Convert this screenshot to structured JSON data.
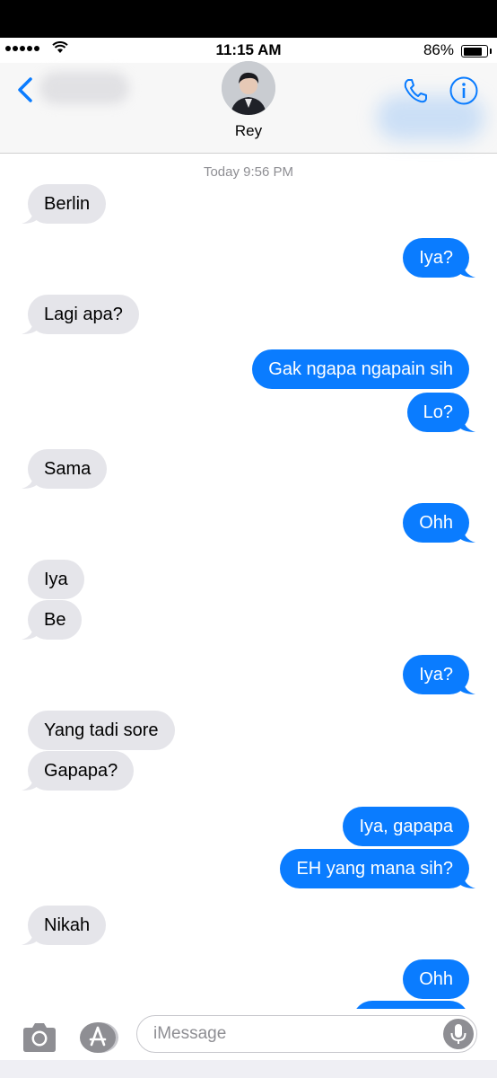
{
  "status_bar": {
    "time": "11:15 AM",
    "battery": "86%"
  },
  "header": {
    "contact_name": "Rey"
  },
  "thread": {
    "timestamp": "Today 9:56 PM",
    "messages": [
      {
        "dir": "in",
        "text": "Berlin"
      },
      {
        "dir": "out",
        "text": "Iya?"
      },
      {
        "dir": "in",
        "text": "Lagi apa?"
      },
      {
        "dir": "out",
        "text": "Gak ngapa ngapain sih"
      },
      {
        "dir": "out",
        "text": "Lo?"
      },
      {
        "dir": "in",
        "text": "Sama"
      },
      {
        "dir": "out",
        "text": "Ohh"
      },
      {
        "dir": "in",
        "text": "Iya"
      },
      {
        "dir": "in",
        "text": "Be"
      },
      {
        "dir": "out",
        "text": "Iya?"
      },
      {
        "dir": "in",
        "text": "Yang tadi sore"
      },
      {
        "dir": "in",
        "text": "Gapapa?"
      },
      {
        "dir": "out",
        "text": "Iya, gapapa"
      },
      {
        "dir": "out",
        "text": "EH yang mana sih?"
      },
      {
        "dir": "in",
        "text": "Nikah"
      },
      {
        "dir": "out",
        "text": "Ohh"
      }
    ]
  },
  "input": {
    "placeholder": "iMessage"
  },
  "colors": {
    "accent": "#0a7cff",
    "incoming_bubble": "#e5e5ea"
  },
  "icons": [
    "back-chevron-icon",
    "phone-icon",
    "info-icon",
    "camera-icon",
    "app-store-icon",
    "microphone-icon"
  ]
}
